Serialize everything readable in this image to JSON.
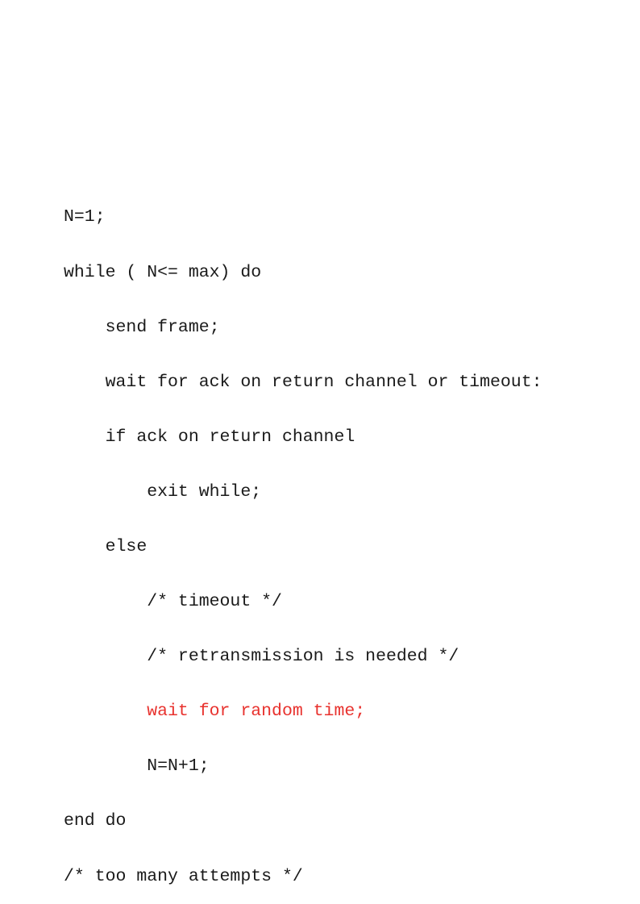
{
  "colors": {
    "text": "#1a1a1a",
    "highlight": "#e8322e",
    "background": "#ffffff"
  },
  "code": {
    "lines": [
      "N=1;",
      "while ( N<= max) do",
      "    send frame;",
      "    wait for ack on return channel or timeout:",
      "    if ack on return channel",
      "        exit while;",
      "    else",
      "        /* timeout */",
      "        /* retransmission is needed */",
      "        wait for random time;",
      "        N=N+1;",
      "end do",
      "/* too many attempts */"
    ],
    "highlighted_line_index": 9
  }
}
